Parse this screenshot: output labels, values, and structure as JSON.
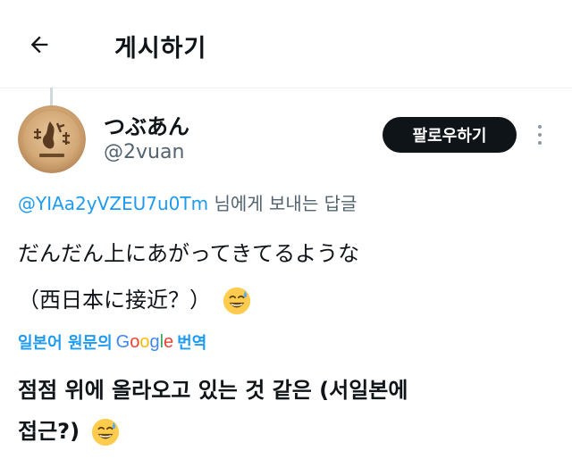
{
  "header": {
    "title": "게시하기",
    "back_icon": "arrow-left-icon"
  },
  "author": {
    "display_name": "つぶあん",
    "handle": "@2vuan",
    "avatar_icon": "round-wooden-stamp-avatar"
  },
  "actions": {
    "follow_label": "팔로우하기",
    "more_icon": "more-vertical-icon"
  },
  "reply": {
    "mention": "@YIAa2yVZEU7u0Tm",
    "suffix": " 님에게 보내는 답글"
  },
  "post": {
    "line1": "だんだん上にあがってきてるような",
    "line2": "（西日本に接近？）",
    "emoji_icon": "sweat-smile-emoji"
  },
  "translation": {
    "prefix": "일본어 원문의",
    "google_letters": [
      "G",
      "o",
      "o",
      "g",
      "l",
      "e"
    ],
    "suffix": "번역",
    "line1": "점점 위에 올라오고 있는 것 같은 (서일본에",
    "line2": "접근?)",
    "google_colors": [
      "#4285F4",
      "#EA4335",
      "#FBBC05",
      "#4285F4",
      "#34A853",
      "#EA4335"
    ]
  },
  "colors": {
    "accent": "#1d9bf0",
    "text": "#0f1419",
    "muted": "#536471",
    "button": "#0f1419"
  }
}
